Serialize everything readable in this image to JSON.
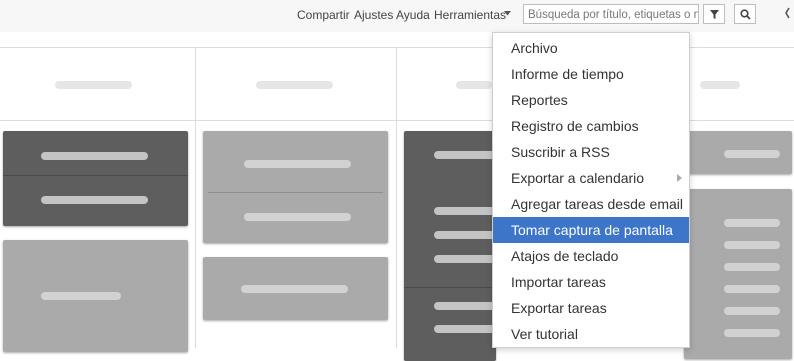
{
  "topbar": {
    "links": [
      "Compartir",
      "Ajustes",
      "Ayuda",
      "Herramientas"
    ],
    "search_placeholder": "Búsqueda por título, etiquetas o notas"
  },
  "icons": [
    "caret-down-icon",
    "filter-icon",
    "search-icon",
    "chevron-left-icon",
    "chevron-right-icon"
  ],
  "menu": {
    "items": [
      "Archivo",
      "Informe de tiempo",
      "Reportes",
      "Registro de cambios",
      "Suscribir a RSS",
      "Exportar a calendario",
      "Agregar tareas desde email",
      "Tomar captura de pantalla",
      "Atajos de teclado",
      "Importar tareas",
      "Exportar tareas",
      "Ver tutorial"
    ],
    "selected": "Tomar captura de pantalla",
    "submenu_item": "Exportar a calendario"
  },
  "colors": {
    "highlight": "#3d76c8",
    "dark_card": "#5e5e5e",
    "light_card": "#aaaaaa"
  }
}
